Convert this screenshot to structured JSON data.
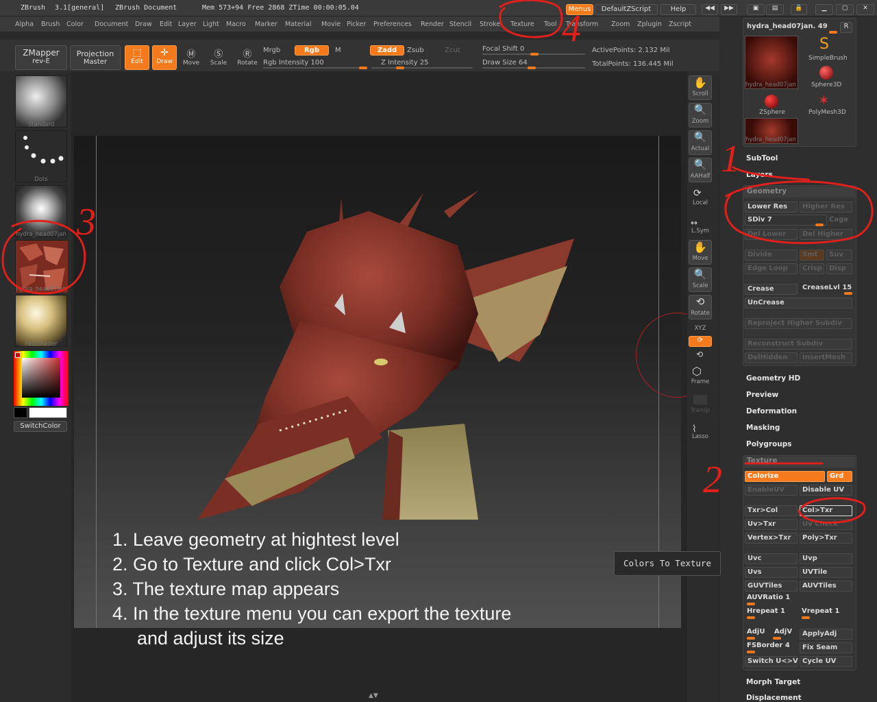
{
  "titlebar": {
    "app": "ZBrush",
    "version": "3.1[general]",
    "document": "ZBrush Document",
    "mem": "Mem 573+94 Free 2868 ZTime 00:00:05.04",
    "menus_btn": "Menus",
    "script_btn": "DefaultZScript",
    "help_btn": "Help"
  },
  "menubar": {
    "items": [
      "Alpha",
      "Brush",
      "Color",
      "Document",
      "Draw",
      "Edit",
      "Layer",
      "Light",
      "Macro",
      "Marker",
      "Material",
      "Movie",
      "Picker",
      "Preferences",
      "Render",
      "Stencil",
      "Stroke",
      "Texture",
      "Tool",
      "Transform",
      "Zoom",
      "Zplugin",
      "Zscript"
    ]
  },
  "toolbar": {
    "zmapper": "ZMapper",
    "zmapper_sub": "rev-E",
    "projection": "Projection",
    "projection_sub": "Master",
    "edit": "Edit",
    "draw": "Draw",
    "move": "Move",
    "scale": "Scale",
    "rotate": "Rotate",
    "mrgb": "Mrgb",
    "rgb": "Rgb",
    "m": "M",
    "rgb_intensity": "Rgb Intensity 100",
    "zadd": "Zadd",
    "zsub": "Zsub",
    "zcut": "Zcut",
    "z_intensity": "Z Intensity 25",
    "focal_shift": "Focal Shift 0",
    "draw_size": "Draw Size 64",
    "active_points": "ActivePoints: 2.132 Mil",
    "total_points": "TotalPoints: 136.445 Mil"
  },
  "left_shelf": {
    "materials": [
      "Standard",
      "Dots",
      "hydra_head07jan",
      "hydra_head07jan",
      "FastShader"
    ],
    "switch_color": "SwitchColor"
  },
  "right_shelf": {
    "buttons": [
      "Scroll",
      "Zoom",
      "Actual",
      "AAHalf",
      "Local",
      "L.Sym",
      "Move",
      "Scale",
      "Rotate",
      "XYZ",
      "",
      "",
      "Frame",
      "Transp",
      "Lasso"
    ]
  },
  "tool_palette": {
    "current": "hydra_head07jan. 49",
    "r": "R",
    "tools": [
      "hydra_head07jan",
      "SimpleBrush",
      "Sphere3D",
      "ZSphere",
      "PolyMesh3D",
      "hydra_head07jan"
    ]
  },
  "subpalettes": {
    "subtool": "SubTool",
    "layers": "Layers",
    "geometry": "Geometry",
    "geometry_hd": "Geometry HD",
    "preview": "Preview",
    "deformation": "Deformation",
    "masking": "Masking",
    "polygroups": "Polygroups",
    "texture": "Texture",
    "morph_target": "Morph Target",
    "displacement": "Displacement"
  },
  "geometry": {
    "lower_res": "Lower Res",
    "higher_res": "Higher Res",
    "sdiv": "SDiv 7",
    "cage": "Cage",
    "del_lower": "Del Lower",
    "del_higher": "Del Higher",
    "divide": "Divide",
    "smt": "Smt",
    "suv": "Suv",
    "edge_loop": "Edge Loop",
    "crisp": "Crisp",
    "disp": "Disp",
    "crease": "Crease",
    "crease_lvl": "CreaseLvl 15",
    "uncrease": "UnCrease",
    "reproject": "Reproject Higher Subdiv",
    "reconstruct": "Reconstruct Subdiv",
    "delhidden": "DelHidden",
    "insertmesh": "InsertMesh"
  },
  "texture": {
    "colorize": "Colorize",
    "grd": "Grd",
    "enable_uv": "EnableUV",
    "disable_uv": "Disable UV",
    "txr_col": "Txr>Col",
    "col_txr": "Col>Txr",
    "uv_txr": "Uv>Txr",
    "uv_check": "Uv Check",
    "vertex_txr": "Vertex>Txr",
    "poly_txr": "Poly>Txr",
    "uvc": "Uvc",
    "uvp": "Uvp",
    "uvs": "Uvs",
    "uvtile": "UVTile",
    "guvtiles": "GUVTiles",
    "auvtiles": "AUVTiles",
    "auvratio": "AUVRatio 1",
    "hrepeat": "Hrepeat 1",
    "vrepeat": "Vrepeat 1",
    "adju": "AdjU",
    "adjv": "AdjV",
    "applyadj": "ApplyAdj",
    "fsborder": "FSBorder 4",
    "fix_seam": "Fix Seam",
    "switch_uv": "Switch U<>V",
    "cycle_uv": "Cycle UV"
  },
  "tooltip": "Colors To Texture",
  "instructions": [
    "1. Leave geometry at hightest level",
    "2. Go to Texture and click Col>Txr",
    "3. The texture map appears",
    "4. In the texture menu you can export the texture",
    "and adjust its size"
  ],
  "annotations": [
    "1",
    "2",
    "3",
    "4"
  ],
  "colors": {
    "accent": "#f47a1c",
    "annotation": "#e0201a",
    "panel": "#2e2e2e",
    "canvas": "#1c1c1c"
  }
}
